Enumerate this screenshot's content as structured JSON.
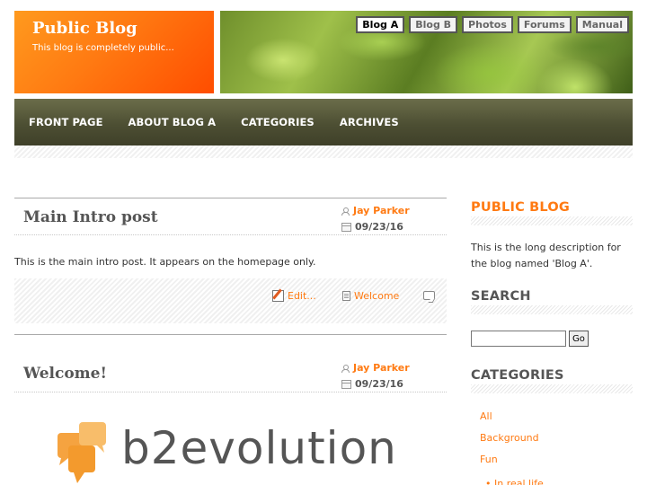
{
  "header": {
    "blog_title": "Public Blog",
    "blog_tagline": "This blog is completely public...",
    "collection_tabs": [
      {
        "label": "Blog A",
        "active": true
      },
      {
        "label": "Blog B",
        "active": false
      },
      {
        "label": "Photos",
        "active": false
      },
      {
        "label": "Forums",
        "active": false
      },
      {
        "label": "Manual",
        "active": false
      }
    ]
  },
  "nav": {
    "items": [
      "FRONT PAGE",
      "ABOUT BLOG A",
      "CATEGORIES",
      "ARCHIVES"
    ]
  },
  "posts": [
    {
      "title": "Main Intro post",
      "author": "Jay Parker",
      "date": "09/23/16",
      "body": "This is the main intro post. It appears on the homepage only.",
      "edit_label": "Edit...",
      "category_link": "Welcome"
    },
    {
      "title": "Welcome!",
      "author": "Jay Parker",
      "date": "09/23/16"
    }
  ],
  "sidebar": {
    "about_title": "PUBLIC BLOG",
    "about_text": "This is the long description for the blog named 'Blog A'.",
    "search_title": "SEARCH",
    "search_button": "Go",
    "categories_title": "CATEGORIES",
    "categories": [
      "All",
      "Background",
      "Fun"
    ],
    "subcategory_partial": "In real life"
  },
  "logo": {
    "wordmark": "b2evolution"
  },
  "colors": {
    "accent": "#ff7a12",
    "nav_bg": "#4d4f33",
    "brand_gradient_start": "#ff9a1e",
    "brand_gradient_end": "#ff4d00",
    "logo_orange": "#f5a340"
  }
}
